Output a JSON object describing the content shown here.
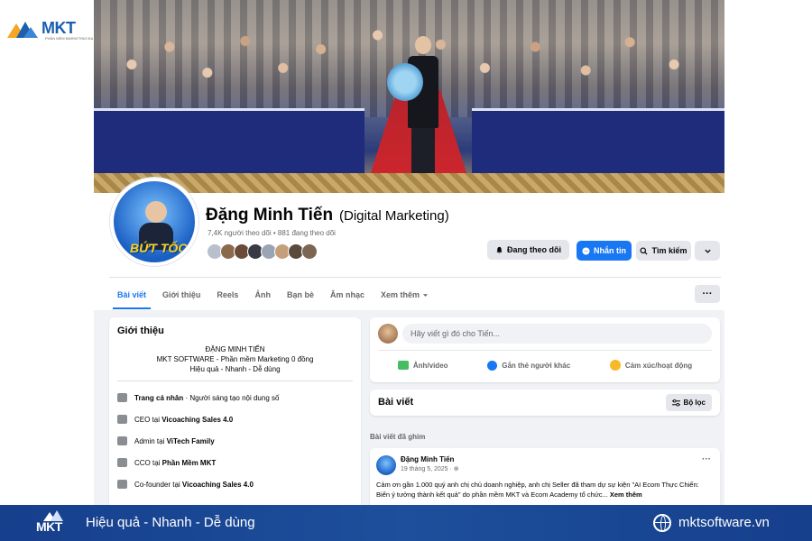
{
  "brand": {
    "logo_text": "MKT",
    "logo_tagline": "PHẦN MỀM MARKETING ĐA KÊNH",
    "colors": {
      "primary": "#1b5fae",
      "orange": "#f5a623",
      "banner": "#163f8c"
    }
  },
  "profile": {
    "name": "Đặng Minh Tiến",
    "subtitle": "(Digital Marketing)",
    "followers": "7,4K người theo dõi • 881 đang theo dõi",
    "avatar_caption": "BỨT TỐC",
    "friend_avatar_count": 8
  },
  "actions": {
    "follow": "Đang theo dõi",
    "message": "Nhắn tin",
    "search": "Tìm kiếm",
    "more_icon": "chevron-down-icon",
    "accent": "#1877f2"
  },
  "tabs": [
    {
      "label": "Bài viết",
      "active": true
    },
    {
      "label": "Giới thiệu",
      "active": false
    },
    {
      "label": "Reels",
      "active": false
    },
    {
      "label": "Ảnh",
      "active": false
    },
    {
      "label": "Bạn bè",
      "active": false
    },
    {
      "label": "Âm nhạc",
      "active": false
    },
    {
      "label": "Xem thêm",
      "active": false
    }
  ],
  "tab_more_button": "···",
  "intro": {
    "title": "Giới thiệu",
    "bio_line1": "ĐẶNG MINH TIẾN",
    "bio_line2": "MKT SOFTWARE - Phần mềm Marketing 0 đồng",
    "bio_line3": "Hiệu quả - Nhanh - Dễ dùng",
    "items": [
      {
        "prefix": "",
        "bold": "Trang cá nhân",
        "suffix": " · Người sáng tạo nội dung số"
      },
      {
        "prefix": "CEO tại ",
        "bold": "Vicoaching Sales 4.0",
        "suffix": ""
      },
      {
        "prefix": "Admin tại ",
        "bold": "ViTech Family",
        "suffix": ""
      },
      {
        "prefix": "CCO tại ",
        "bold": "Phần Mềm MKT",
        "suffix": ""
      },
      {
        "prefix": "Co-founder tại ",
        "bold": "Vicoaching Sales 4.0",
        "suffix": ""
      }
    ]
  },
  "composer": {
    "placeholder": "Hãy viết gì đó cho Tiến...",
    "photo": "Ảnh/video",
    "tag": "Gắn thẻ người khác",
    "feeling": "Cảm xúc/hoạt động"
  },
  "posts": {
    "title": "Bài viết",
    "filter": "Bộ lọc",
    "pinned_label": "Bài viết đã ghim"
  },
  "post": {
    "author": "Đặng Minh Tiến",
    "date": "19 tháng 5, 2025 · ⊕",
    "more": "···",
    "text": "Cảm ơn gần 1.000 quý anh chị chủ doanh nghiệp, anh chị Seller đã tham dự sự kiện \"AI Ecom Thực Chiến: Biến ý tưởng thành kết quả\" do phần mềm MKT và Ecom Academy tổ chức... ",
    "see_more": "Xem thêm"
  },
  "banner": {
    "logo": "MKT",
    "slogan": "Hiệu quả - Nhanh - Dễ dùng",
    "website": "mktsoftware.vn"
  }
}
